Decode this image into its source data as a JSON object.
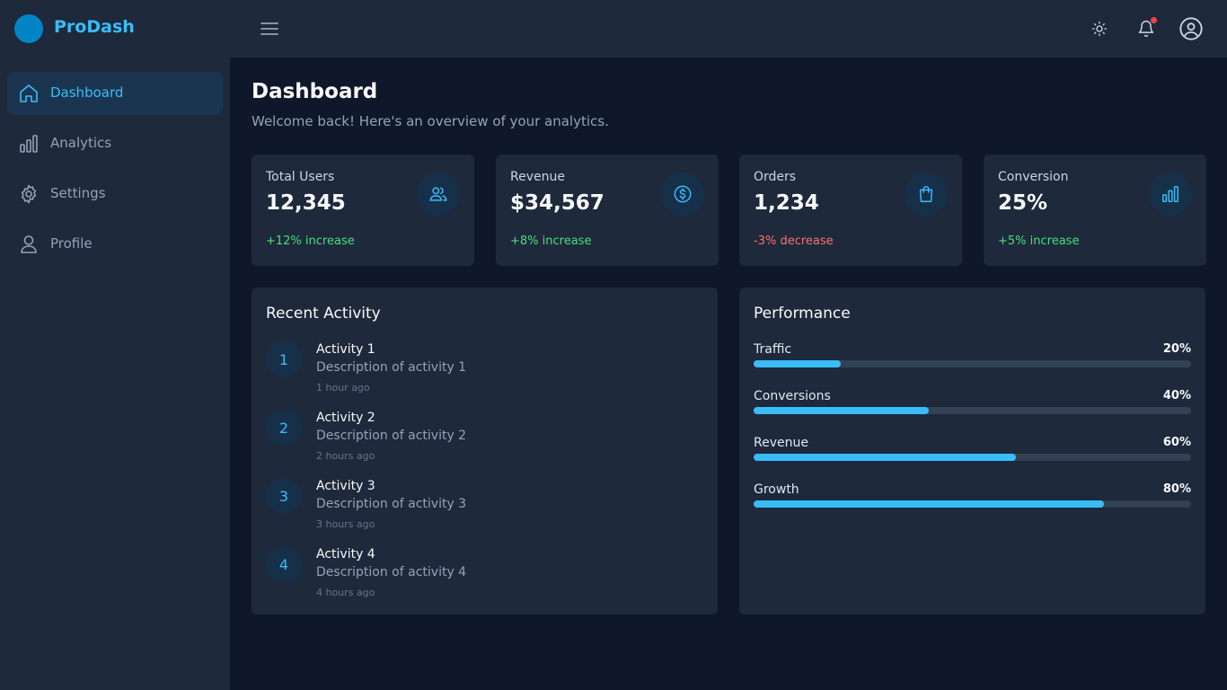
{
  "app": {
    "brand": "ProDash"
  },
  "header": {
    "theme_icon": "sun-icon",
    "notification_icon": "bell-icon",
    "profile_icon": "user-circle-icon",
    "menu_icon": "hamburger-icon"
  },
  "sidebar": {
    "items": [
      {
        "label": "Dashboard",
        "icon": "home-icon",
        "active": true
      },
      {
        "label": "Analytics",
        "icon": "bar-chart-icon",
        "active": false
      },
      {
        "label": "Settings",
        "icon": "gear-icon",
        "active": false
      },
      {
        "label": "Profile",
        "icon": "user-icon",
        "active": false
      }
    ]
  },
  "page": {
    "title": "Dashboard",
    "subtitle": "Welcome back! Here's an overview of your analytics."
  },
  "stats": [
    {
      "label": "Total Users",
      "value": "12,345",
      "change": "+12% increase",
      "trend": "up",
      "icon": "users-icon"
    },
    {
      "label": "Revenue",
      "value": "$34,567",
      "change": "+8% increase",
      "trend": "up",
      "icon": "dollar-icon"
    },
    {
      "label": "Orders",
      "value": "1,234",
      "change": "-3% decrease",
      "trend": "down",
      "icon": "shopping-bag-icon"
    },
    {
      "label": "Conversion",
      "value": "25%",
      "change": "+5% increase",
      "trend": "up",
      "icon": "bar-chart-icon"
    }
  ],
  "activity": {
    "title": "Recent Activity",
    "items": [
      {
        "num": "1",
        "title": "Activity 1",
        "desc": "Description of activity 1",
        "time": "1 hour ago"
      },
      {
        "num": "2",
        "title": "Activity 2",
        "desc": "Description of activity 2",
        "time": "2 hours ago"
      },
      {
        "num": "3",
        "title": "Activity 3",
        "desc": "Description of activity 3",
        "time": "3 hours ago"
      },
      {
        "num": "4",
        "title": "Activity 4",
        "desc": "Description of activity 4",
        "time": "4 hours ago"
      }
    ]
  },
  "performance": {
    "title": "Performance",
    "items": [
      {
        "label": "Traffic",
        "display": "20%",
        "value": 20
      },
      {
        "label": "Conversions",
        "display": "40%",
        "value": 40
      },
      {
        "label": "Revenue",
        "display": "60%",
        "value": 60
      },
      {
        "label": "Growth",
        "display": "80%",
        "value": 80
      }
    ]
  },
  "colors": {
    "accent": "#38bdf8",
    "positive": "#4ade80",
    "negative": "#f87171",
    "background": "#0f172a",
    "surface": "#1e293b"
  }
}
